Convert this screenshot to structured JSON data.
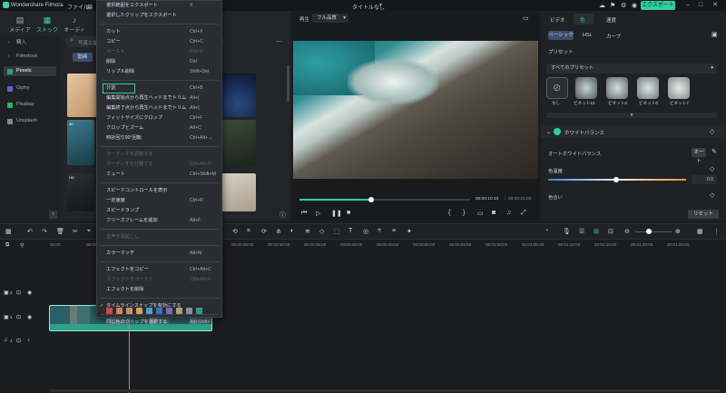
{
  "app": {
    "name": "Wondershare Filmora",
    "menus": [
      "ファイル",
      "編"
    ],
    "title": "タイトルなし",
    "export_label": "エクスポート"
  },
  "left_panel": {
    "tabs": [
      {
        "label": "メディア",
        "icon": "media-icon"
      },
      {
        "label": "ストック",
        "icon": "stock-icon"
      },
      {
        "label": "オーディオ",
        "icon": "audio-icon"
      }
    ],
    "sidebar": [
      {
        "label": "購入",
        "icon": "chevron-right-icon"
      },
      {
        "label": "Filmstock",
        "icon": "chevron-right-icon"
      },
      {
        "label": "Pexels",
        "icon": "pexels-icon"
      },
      {
        "label": "Giphy",
        "icon": "giphy-icon"
      },
      {
        "label": "Pixabay",
        "icon": "pixabay-icon"
      },
      {
        "label": "Unsplash",
        "icon": "unsplash-icon"
      }
    ],
    "search_placeholder": "写真と動",
    "filter_chip": "動画",
    "thumb_badges": [
      "4K",
      "4K",
      "HD"
    ]
  },
  "preview": {
    "tab_play": "再生",
    "quality": "フル品質",
    "time_current": "00:00:10:10",
    "time_total": "00:00:21:03",
    "progress": 0.42
  },
  "right_panel": {
    "tabs": [
      "ビデオ",
      "色",
      "速度"
    ],
    "subtabs": [
      "ベーシック",
      "HSL",
      "カーブ"
    ],
    "preset_heading": "プリセット",
    "preset_select": "すべてのプリセット",
    "presets": [
      "なし",
      "ビネット10",
      "ビネット8",
      "ビネット6",
      "ビネット7"
    ],
    "white_balance": "ホワイトバランス",
    "auto_white_balance": "オートホワイトバランス",
    "auto_label": "オート",
    "color_temp_label": "色温度",
    "color_temp_value": "0.0",
    "tint_label": "色合い",
    "reset_label": "リセット"
  },
  "context_menu": {
    "items": [
      {
        "label": "選択範囲をエクスポート",
        "shortcut": "X",
        "enabled": true
      },
      {
        "label": "選択したクリップをエクスポート",
        "shortcut": "",
        "enabled": true
      },
      {
        "sep": true
      },
      {
        "label": "カット",
        "shortcut": "Ctrl+X",
        "enabled": true
      },
      {
        "label": "コピー",
        "shortcut": "Ctrl+C",
        "enabled": true
      },
      {
        "label": "ペースト",
        "shortcut": "Ctrl+V",
        "enabled": false
      },
      {
        "label": "削除",
        "shortcut": "Del",
        "enabled": true
      },
      {
        "label": "リップル削除",
        "shortcut": "Shift+Del",
        "enabled": true
      },
      {
        "sep": true
      },
      {
        "label": "分割",
        "shortcut": "Ctrl+B",
        "enabled": true,
        "highlight": true
      },
      {
        "label": "編集開始点から再生ヘッドまでトリム",
        "shortcut": "Alt+[",
        "enabled": true
      },
      {
        "label": "編集終了点から再生ヘッドまでトリム",
        "shortcut": "Alt+]",
        "enabled": true
      },
      {
        "label": "フィットサイズにクロップ",
        "shortcut": "Ctrl+F",
        "enabled": true
      },
      {
        "label": "クロップとズーム",
        "shortcut": "Alt+C",
        "enabled": true
      },
      {
        "label": "時計回り90°回転",
        "shortcut": "Ctrl+Alt+→",
        "enabled": true
      },
      {
        "sep": true
      },
      {
        "label": "オーディオを調整する",
        "shortcut": "",
        "enabled": false
      },
      {
        "label": "オーディオを分離する",
        "shortcut": "Ctrl+Alt+D",
        "enabled": false
      },
      {
        "label": "ミュート",
        "shortcut": "Ctrl+Shift+M",
        "enabled": true
      },
      {
        "sep": true
      },
      {
        "label": "スピードコントロールを表示",
        "shortcut": "",
        "enabled": true
      },
      {
        "label": "一定速度",
        "shortcut": "Ctrl+R",
        "enabled": true
      },
      {
        "label": "スピードランプ",
        "shortcut": "",
        "enabled": true
      },
      {
        "label": "フリーズフレームを追加",
        "shortcut": "Alt+F",
        "enabled": true
      },
      {
        "sep": true
      },
      {
        "label": "音声字幕起こし",
        "shortcut": "",
        "enabled": false
      },
      {
        "sep": true
      },
      {
        "label": "カラーマッチ",
        "shortcut": "Alt+M",
        "enabled": true
      },
      {
        "sep": true
      },
      {
        "label": "エフェクトをコピー",
        "shortcut": "Ctrl+Alt+C",
        "enabled": true
      },
      {
        "label": "エフェクトをペースト",
        "shortcut": "Ctrl+Alt+V",
        "enabled": false
      },
      {
        "label": "エフェクトを削除",
        "shortcut": "",
        "enabled": true
      },
      {
        "sep": true
      },
      {
        "label": "タイムラインスナップを有効にする",
        "shortcut": "",
        "enabled": true,
        "checked": true
      },
      {
        "sep": true
      },
      {
        "label": "同じ色のクリップを選択する",
        "shortcut": "Alt+Shift+`",
        "enabled": true
      }
    ],
    "swatch_colors": [
      "#c0504d",
      "#d9825b",
      "#c8926a",
      "#d4a45a",
      "#4aa3c8",
      "#3a74b5",
      "#7c6bb3",
      "#b0a070",
      "#8a8f98",
      "#2e9e88"
    ]
  },
  "timeline": {
    "ruler": [
      "00:00",
      "00:00:05:00",
      "00:00:10:00",
      "00:00:15:00",
      "00:00:20:00",
      "00:00:25:00",
      "00:00:30:00",
      "00:00:35:00",
      "00:00:40:00",
      "00:00:45:00",
      "00:00:50:00",
      "00:00:55:00",
      "00:01:00:00",
      "00:01:05:00",
      "00:01:10:00",
      "00:01:15:00",
      "00:01:20:00",
      "00:01:25:00"
    ],
    "tracks": [
      "2",
      "1",
      "1"
    ]
  }
}
